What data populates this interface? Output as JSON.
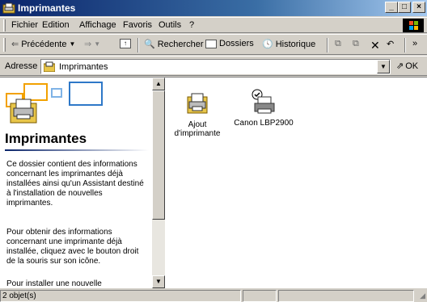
{
  "window": {
    "title": "Imprimantes"
  },
  "menu": [
    "Fichier",
    "Edition",
    "Affichage",
    "Favoris",
    "Outils",
    "?"
  ],
  "toolbar": {
    "back": "Précédente",
    "search": "Rechercher",
    "folders": "Dossiers",
    "history": "Historique",
    "more": "»"
  },
  "address": {
    "label": "Adresse",
    "value": "Imprimantes",
    "go": "OK"
  },
  "left_pane": {
    "title": "Imprimantes",
    "paragraph1": "Ce dossier contient des informations concernant les imprimantes déjà installées ainsi qu'un Assistant destiné à l'installation de nouvelles imprimantes.",
    "paragraph2": "Pour obtenir des informations concernant une imprimante déjà installée, cliquez avec le bouton droit de la souris sur son icône.",
    "paragraph3": "Pour installer une nouvelle"
  },
  "items": [
    {
      "label": "Ajout d'imprimante",
      "icon": "add-printer-icon"
    },
    {
      "label": "Canon LBP2900",
      "icon": "printer-icon"
    }
  ],
  "status": {
    "count": "2 objet(s)"
  }
}
